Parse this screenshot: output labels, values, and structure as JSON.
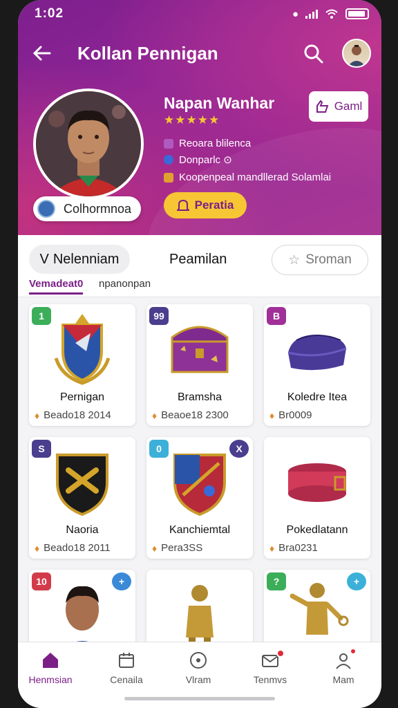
{
  "status": {
    "time": "1:02"
  },
  "header": {
    "title": "Kollan Pennigan"
  },
  "profile": {
    "name": "Napan Wanhar",
    "stars": "★★★★★",
    "badge": "Colhormnoa",
    "info": [
      "Reoara blilenca",
      "Donparlc ⊙",
      "Koopenpeal mandllerad Solamlai"
    ],
    "follow_label": "Gaml",
    "action_label": "Peratia"
  },
  "tabs": {
    "primary": "Nelenniam",
    "primary_prefix": "V",
    "secondary": "Peamilan",
    "search_label": "Sroman",
    "sub_active": "Vemadeat0",
    "sub_other": "npanonpan"
  },
  "cards": [
    {
      "num": "1",
      "num_color": "#3cae5a",
      "name": "Pernigan",
      "price": "Beado18 2014",
      "art": "crest-blue"
    },
    {
      "num": "99",
      "num_color": "#4a3e8e",
      "name": "Bramsha",
      "price": "Beaoe18 2300",
      "art": "chest-purple"
    },
    {
      "num": "B",
      "num_color": "#a03098",
      "name": "Koledre Itea",
      "price": "Br0009",
      "art": "pouch-purple"
    },
    {
      "num": "S",
      "num_color": "#4a3e8e",
      "name": "Naoria",
      "price": "Beado18 2011",
      "art": "shield-black"
    },
    {
      "num": "0",
      "num_color": "#3cb0d8",
      "name": "Kanchiemtal",
      "price": "Pera3SS",
      "art": "shield-red",
      "num2": "X",
      "num2_color": "#4a3e8e"
    },
    {
      "num": "",
      "num_color": "",
      "name": "Pokedlatann",
      "price": "Bra0231",
      "art": "collar-red"
    },
    {
      "num": "10",
      "num_color": "#d33a4a",
      "name": "",
      "price": "",
      "art": "player",
      "num2": "+",
      "num2_color": "#3a8ad8"
    },
    {
      "num": "",
      "num_color": "",
      "name": "",
      "price": "",
      "art": "statue-gold"
    },
    {
      "num": "?",
      "num_color": "#3cae5a",
      "name": "",
      "price": "",
      "art": "statue-gold2",
      "num2": "+",
      "num2_color": "#3cb0d8"
    }
  ],
  "nav": [
    {
      "label": "Henmsian",
      "icon": "home-icon",
      "active": true
    },
    {
      "label": "Cenaila",
      "icon": "calendar-icon",
      "active": false
    },
    {
      "label": "Vlram",
      "icon": "compass-icon",
      "active": false
    },
    {
      "label": "Tenmvs",
      "icon": "mail-icon",
      "active": false
    },
    {
      "label": "Mam",
      "icon": "profile-icon",
      "active": false
    }
  ],
  "colors": {
    "accent": "#7b1f87",
    "gold": "#f7c634"
  }
}
